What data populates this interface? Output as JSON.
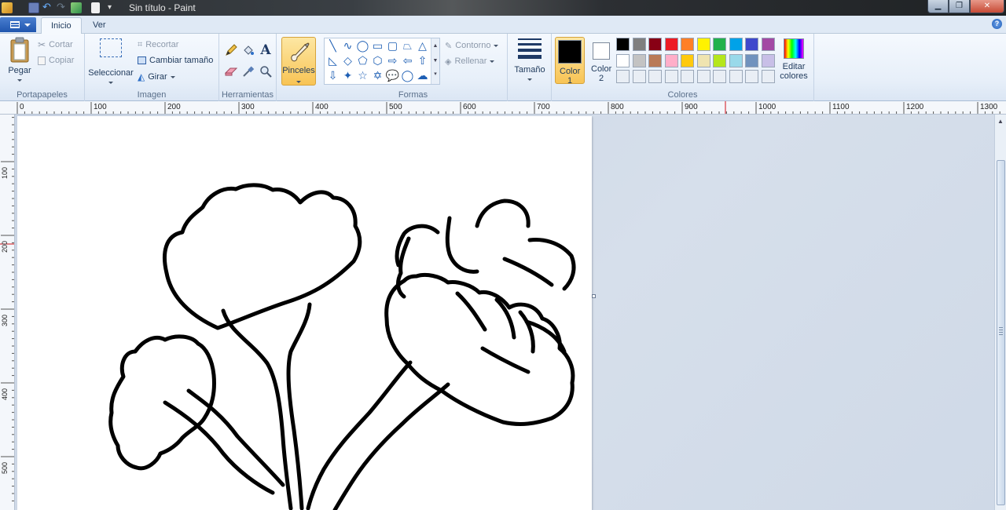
{
  "window": {
    "title": "Sin título - Paint"
  },
  "tabs": {
    "home": "Inicio",
    "view": "Ver"
  },
  "clipboard": {
    "paste": "Pegar",
    "cut": "Cortar",
    "copy": "Copiar",
    "label": "Portapapeles"
  },
  "image": {
    "select": "Seleccionar",
    "crop": "Recortar",
    "resize": "Cambiar tamaño",
    "rotate": "Girar",
    "label": "Imagen"
  },
  "tools": {
    "label": "Herramientas"
  },
  "brushes": {
    "label": "Pinceles"
  },
  "shapes": {
    "outline": "Contorno",
    "fill": "Rellenar",
    "label": "Formas"
  },
  "size": {
    "label": "Tamaño"
  },
  "colors": {
    "color1": "Color 1",
    "color2": "Color 2",
    "edit_line1": "Editar",
    "edit_line2": "colores",
    "label": "Colores",
    "color1_value": "#000000",
    "color2_value": "#ffffff",
    "palette_row1": [
      "#000000",
      "#7f7f7f",
      "#880015",
      "#ed1c24",
      "#ff7f27",
      "#fff200",
      "#22b14c",
      "#00a2e8",
      "#3f48cc",
      "#a349a4"
    ],
    "palette_row2": [
      "#ffffff",
      "#c3c3c3",
      "#b97a57",
      "#ffaec9",
      "#ffc90e",
      "#efe4b0",
      "#b5e61d",
      "#99d9ea",
      "#7092be",
      "#c8bfe7"
    ],
    "palette_row3": [
      "#e9eef5",
      "#e9eef5",
      "#e9eef5",
      "#e9eef5",
      "#e9eef5",
      "#e9eef5",
      "#e9eef5",
      "#e9eef5",
      "#e9eef5",
      "#e9eef5"
    ]
  },
  "ruler": {
    "top": [
      "0",
      "100",
      "200",
      "300",
      "400",
      "500",
      "600",
      "700",
      "800",
      "900",
      "1000",
      "1100",
      "1200",
      "1300"
    ],
    "left": [
      "100",
      "200",
      "300",
      "400",
      "500"
    ]
  },
  "help": "?"
}
